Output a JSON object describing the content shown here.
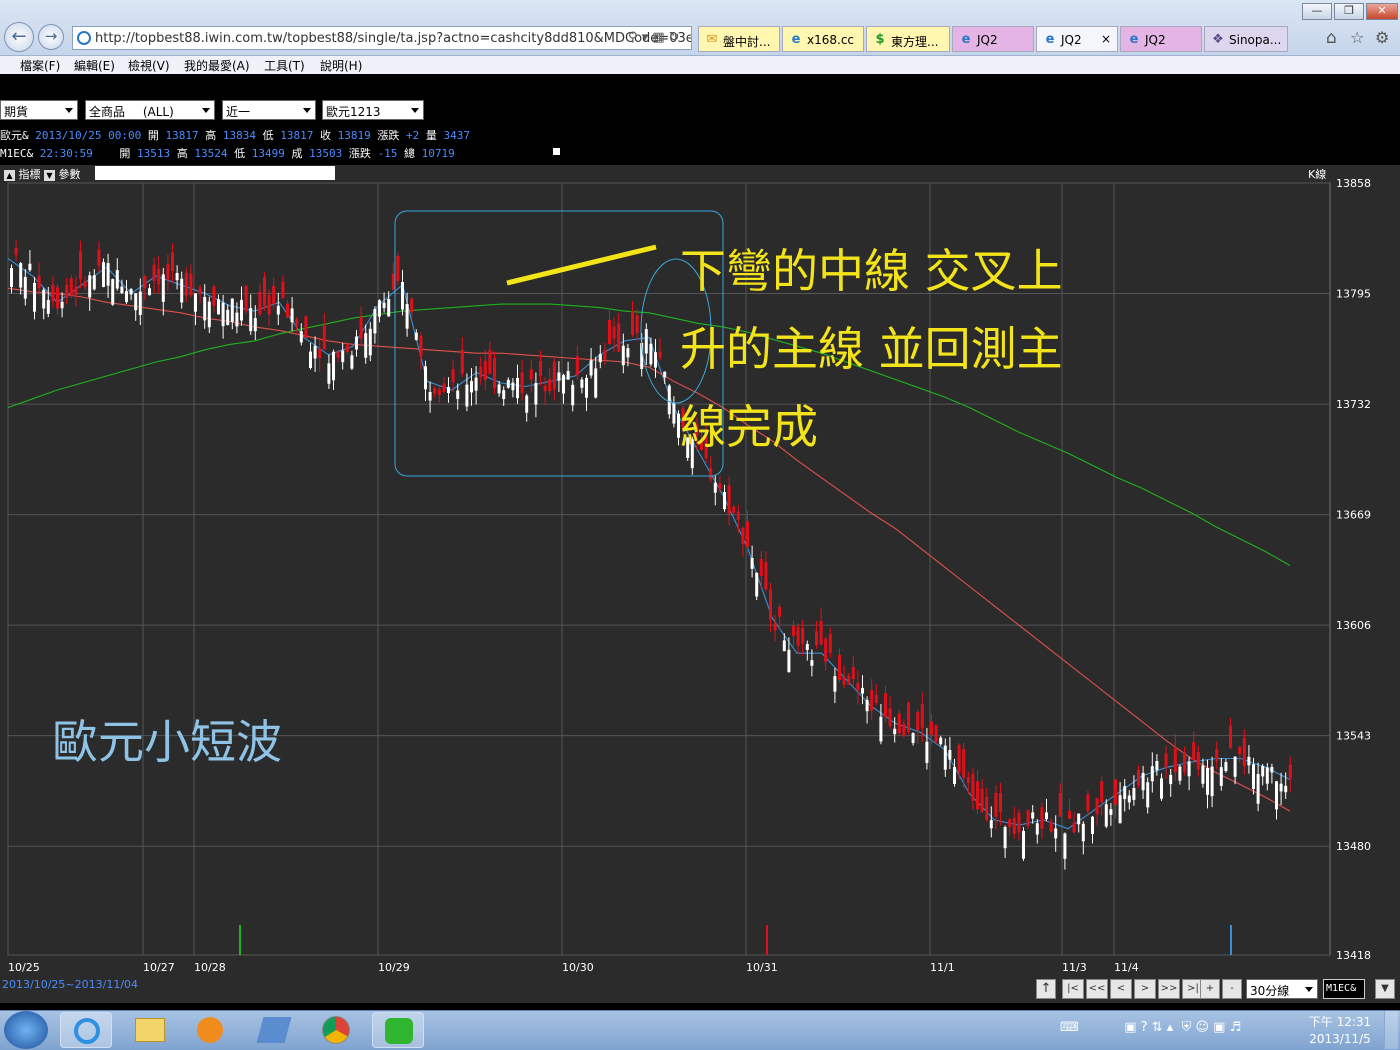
{
  "browser": {
    "url": "http://topbest88.iwin.com.tw/topbest88/single/ta.jsp?actno=cashcity8dd810&MDCode=03e",
    "tabs": [
      {
        "label": "盤中討...",
        "icon": "folder-icon"
      },
      {
        "label": "x168.cc",
        "icon": "ie-icon"
      },
      {
        "label": "東方理...",
        "icon": "dollar-icon"
      },
      {
        "label": "JQ2",
        "icon": "ie-icon"
      },
      {
        "label": "JQ2",
        "icon": "ie-icon",
        "active": true,
        "close": "×"
      },
      {
        "label": "JQ2",
        "icon": "ie-icon"
      },
      {
        "label": "Sinopa...",
        "icon": "sinopac-icon"
      }
    ],
    "menu": [
      "檔案(F)",
      "編輯(E)",
      "檢視(V)",
      "我的最愛(A)",
      "工具(T)",
      "說明(H)"
    ]
  },
  "toolbar": {
    "market": "期貨",
    "product": "全商品",
    "product_filter": "(ALL)",
    "period": "近一",
    "symbol": "歐元1213"
  },
  "quote1": {
    "name": "歐元&",
    "datetime": "2013/10/25 00:00",
    "open_label": "開",
    "open": "13817",
    "high_label": "高",
    "high": "13834",
    "low_label": "低",
    "low": "13817",
    "close_label": "收",
    "close": "13819",
    "change_label": "漲跌",
    "change": "+2",
    "vol_label": "量",
    "vol": "3437"
  },
  "quote2": {
    "name": "M1EC&",
    "time": "22:30:59",
    "open_label": "開",
    "open": "13513",
    "high_label": "高",
    "high": "13524",
    "low_label": "低",
    "low": "13499",
    "close_label": "成",
    "close": "13503",
    "change_label": "漲跌",
    "change": "-15",
    "vol_label": "總",
    "vol": "10719"
  },
  "panel": {
    "indicator_label": "指標",
    "param_label": "參數",
    "kline_label": "K線",
    "date_range": "2013/10/25~2013/11/04",
    "interval": "30分線",
    "symbol_code": "M1EC&"
  },
  "nav_buttons": [
    "|<",
    "<<",
    "<",
    ">",
    ">>",
    ">|",
    "+",
    "-"
  ],
  "annotation": {
    "line1": "下彎的中線 交叉上",
    "line2": "升的主線 並回測主",
    "line3": "線完成",
    "watermark": "歐元小短波"
  },
  "taskbar": {
    "time": "下午 12:31",
    "date": "2013/11/5"
  },
  "colors": {
    "up_candle": "#e0101a",
    "down_candle": "#ffffff",
    "ma_short": "#3a8fd6",
    "ma_mid": "#e0504a",
    "ma_long": "#1fb31f",
    "annotation_text": "#f3e41a",
    "watermark_text": "#8fc3e6",
    "box_stroke": "#3aa7d8"
  },
  "chart_data": {
    "type": "line",
    "title": "",
    "ylim": [
      13418,
      13858
    ],
    "y_ticks": [
      13858,
      13795,
      13732,
      13669,
      13606,
      13543,
      13480,
      13418
    ],
    "x_ticks": [
      "10/25",
      "10/27",
      "10/28",
      "10/29",
      "10/30",
      "10/31",
      "11/1",
      "11/3",
      "11/4"
    ],
    "series": [
      {
        "name": "",
        "values": [
          13815,
          13805,
          13790,
          13800,
          13810,
          13795,
          13805,
          13800,
          13795,
          13788,
          13785,
          13790,
          13770,
          13760,
          13765,
          13788,
          13800,
          13745,
          13740,
          13750,
          13744,
          13742,
          13745,
          13748,
          13760,
          13768,
          13770,
          13730,
          13705,
          13680,
          13650,
          13610,
          13590,
          13590,
          13575,
          13560,
          13550,
          13545,
          13535,
          13510,
          13495,
          13492,
          13495,
          13490,
          13500,
          13510,
          13520,
          13525,
          13528,
          13530,
          13530,
          13525,
          13518
        ]
      },
      {
        "name": "",
        "values": [
          13798,
          13796,
          13795,
          13793,
          13790,
          13788,
          13786,
          13784,
          13781,
          13779,
          13776,
          13774,
          13771,
          13768,
          13766,
          13765,
          13764,
          13763,
          13762,
          13761,
          13761,
          13760,
          13759,
          13758,
          13757,
          13756,
          13753,
          13745,
          13738,
          13730,
          13720,
          13711,
          13700,
          13690,
          13680,
          13670,
          13661,
          13650,
          13639,
          13628,
          13617,
          13606,
          13595,
          13584,
          13573,
          13562,
          13551,
          13540,
          13530,
          13522,
          13515,
          13508,
          13500
        ]
      },
      {
        "name": "",
        "values": [
          13730,
          13735,
          13740,
          13744,
          13748,
          13752,
          13756,
          13759,
          13763,
          13766,
          13768,
          13772,
          13775,
          13778,
          13781,
          13783,
          13785,
          13786,
          13787,
          13788,
          13789,
          13789,
          13789,
          13788,
          13787,
          13785,
          13784,
          13781,
          13778,
          13776,
          13773,
          13769,
          13765,
          13761,
          13756,
          13751,
          13746,
          13741,
          13736,
          13730,
          13723,
          13716,
          13710,
          13704,
          13697,
          13690,
          13684,
          13677,
          13670,
          13662,
          13655,
          13648,
          13640
        ]
      }
    ],
    "volume_spikes": [
      {
        "x": "10/27",
        "color": "green"
      },
      {
        "x": "10/31",
        "color": "red"
      },
      {
        "x": "11/4",
        "color": "blue"
      }
    ]
  }
}
